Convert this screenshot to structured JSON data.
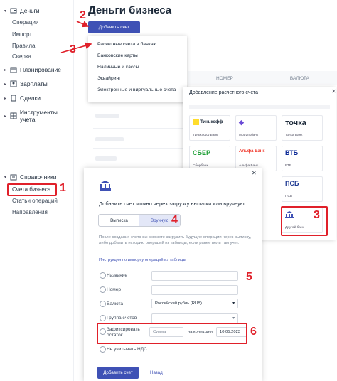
{
  "sidebar": {
    "sections": [
      {
        "label": "Деньги",
        "expanded": true,
        "subitems": [
          "Операции",
          "Импорт",
          "Правила",
          "Сверка"
        ]
      },
      {
        "label": "Планирование"
      },
      {
        "label": "Зарплаты"
      },
      {
        "label": "Сделки"
      },
      {
        "label": "Инструменты учета"
      },
      {
        "label": "Справочники",
        "expanded": true,
        "subitems": [
          "Счета бизнеса",
          "Статьи операций",
          "Направления"
        ]
      }
    ]
  },
  "page": {
    "title": "Деньги бизнеса"
  },
  "add_button": {
    "label": "Добавить счет"
  },
  "dropdown": {
    "items": [
      "Расчетные счета в банках",
      "Банковские карты",
      "Наличные и кассы",
      "Эквайринг",
      "Электронные и виртуальные счета"
    ]
  },
  "table": {
    "columns": [
      "НОМЕР",
      "ВАЛЮТА"
    ]
  },
  "bank_panel": {
    "title": "Добавление расчетного счета",
    "close": "✕",
    "banks": [
      {
        "logo": "Тинькофф",
        "name": "Тинькофф Банк",
        "color": "#1d2a3a",
        "bg": "#ffdd2d"
      },
      {
        "logo": "◆",
        "name": "Модульбанк",
        "color": "#6b4bd6"
      },
      {
        "logo": "точка",
        "name": "Точка Банк",
        "color": "#1d2a3a"
      },
      {
        "logo": "СБЕР",
        "name": "Сбербанк",
        "color": "#21a038"
      },
      {
        "logo": "Альфа Банк",
        "name": "Альфа Банк",
        "color": "#ef3124"
      },
      {
        "logo": "ВТБ",
        "name": "ВТБ",
        "color": "#0a2896"
      },
      {
        "logo": "ПСБ",
        "name": "ПСБ",
        "color": "#1f3a93"
      },
      {
        "logo": "🏛",
        "name": "Другой банк",
        "color": "#3f51b5"
      }
    ]
  },
  "form": {
    "close": "✕",
    "heading": "Добавить счет можно через загрузку выписки или вручную",
    "tabs": {
      "statement": "Выписка",
      "manual": "Вручную"
    },
    "note": "После создания счета вы сможете загрузить будущие операции через выписку, либо добавить историю операций из таблицы, если ранее вели там учет.",
    "link": "Инструкция по импорту операций из таблицы",
    "fields": {
      "name": "Название",
      "number": "Номер",
      "currency": "Валюта",
      "currency_value": "Российский рубль (RUB)",
      "group": "Группа счетов",
      "fix_balance": "Зафиксировать остаток",
      "amount_placeholder": "Сумма",
      "on_date": "на конец дня",
      "date": "10.05.2023",
      "no_vat": "Не учитывать НДС"
    },
    "submit": "Добавить счет",
    "back": "Назад"
  },
  "annotations": [
    "1",
    "2",
    "3",
    "3",
    "4",
    "5",
    "6"
  ],
  "colors": {
    "accent": "#3f51b5",
    "annotation": "#e0202a"
  }
}
